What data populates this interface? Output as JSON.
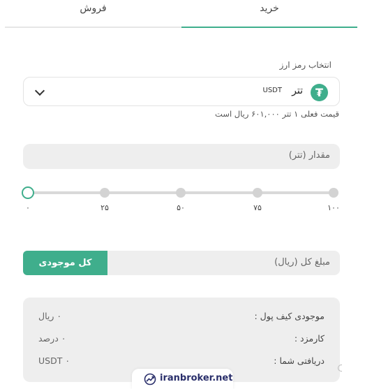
{
  "tabs": {
    "buy": "خرید",
    "sell": "فروش",
    "active": "buy"
  },
  "coin": {
    "label": "انتخاب رمز ارز",
    "name": "تتر",
    "code": "USDT",
    "icon_glyph": "₮",
    "icon_name": "tether-icon",
    "price_note": "قیمت فعلی ۱ تتر ۶۰۱,۰۰۰ ریال است"
  },
  "amount": {
    "placeholder": "مقدار (تتر)"
  },
  "slider": {
    "value_percent": 0,
    "labels": [
      "۰",
      "۲۵",
      "۵۰",
      "۷۵",
      "۱۰۰"
    ]
  },
  "total": {
    "placeholder": "مبلغ کل (ریال)",
    "all_button": "کل موجودی"
  },
  "info": {
    "rows": [
      {
        "key": "موجودی کیف پول :",
        "value": "۰ ریال"
      },
      {
        "key": "کارمزد :",
        "value": "۰ درصد"
      },
      {
        "key": "دریافتی شما :",
        "value": "USDT ۰"
      }
    ]
  },
  "watermark": {
    "text": "iranbroker.net"
  },
  "colors": {
    "accent": "#3fae8c",
    "field_bg": "#eeeeee",
    "track": "#d9d9d9"
  }
}
